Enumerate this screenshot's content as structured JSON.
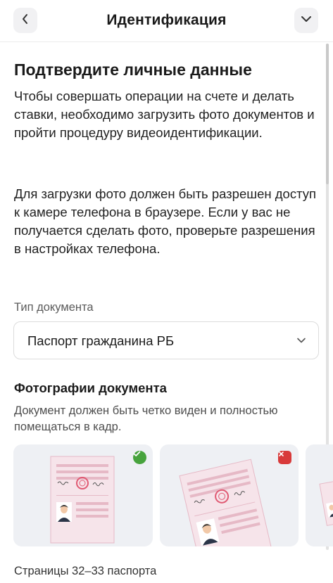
{
  "header": {
    "title": "Идентификация",
    "back_icon": "chevron-left-icon",
    "menu_icon": "chevron-down-icon"
  },
  "main": {
    "title": "Подтвердите личные данные",
    "paragraph1": "Чтобы совершать операции на счете и делать ставки, необходимо загрузить фото документов и пройти процедуру видеоидентификации.",
    "paragraph2": "Для загрузки фото должен быть разрешен доступ к камере телефона в браузере. Если у вас не получается сделать фото, проверьте разрешения в настройках телефона."
  },
  "document_type": {
    "label": "Тип документа",
    "value": "Паспорт гражданина РБ"
  },
  "photos": {
    "title": "Фотографии документа",
    "hint": "Документ должен быть четко виден и полностью помещаться в кадр.",
    "examples": [
      {
        "status": "correct",
        "icon": "check-icon",
        "color": "#47a33d"
      },
      {
        "status": "incorrect",
        "icon": "close-icon",
        "color": "#d83a3a"
      },
      {
        "status": "incorrect",
        "icon": "document-icon"
      }
    ]
  },
  "pages_label": "Страницы 32–33 паспорта",
  "colors": {
    "card_bg": "#eef0f4",
    "doc_fill": "#f6e4ea",
    "doc_line": "#e6b9c6",
    "stamp": "#e05a73",
    "success": "#47a33d",
    "error": "#d83a3a"
  }
}
